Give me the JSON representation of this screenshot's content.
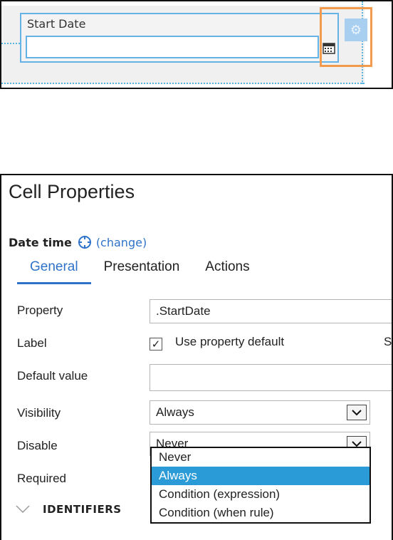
{
  "top": {
    "field_label": "Start Date"
  },
  "props": {
    "title": "Cell Properties",
    "control_type": "Date time",
    "change_link": "(change)",
    "tabs": [
      {
        "label": "General"
      },
      {
        "label": "Presentation"
      },
      {
        "label": "Actions"
      }
    ],
    "rows": {
      "property_label": "Property",
      "property_value": ".StartDate",
      "label_label": "Label",
      "use_default_label": "Use property default",
      "cut_letter": "S",
      "default_value_label": "Default value",
      "default_value": "",
      "visibility_label": "Visibility",
      "visibility_value": "Always",
      "disable_label": "Disable",
      "disable_value": "Never",
      "required_label": "Required"
    },
    "dropdown_options": [
      {
        "label": "Never"
      },
      {
        "label": "Always"
      },
      {
        "label": "Condition (expression)"
      },
      {
        "label": "Condition (when rule)"
      }
    ],
    "section": "IDENTIFIERS"
  },
  "colors": {
    "accent": "#2e73c9",
    "highlight": "#f29a4d",
    "selected_option": "#2a9bd6",
    "design_outline": "#64b2e6"
  },
  "icons": [
    "calendar-icon",
    "gear-icon",
    "crosshair-icon",
    "checkmark-icon",
    "chevron-down-icon"
  ]
}
